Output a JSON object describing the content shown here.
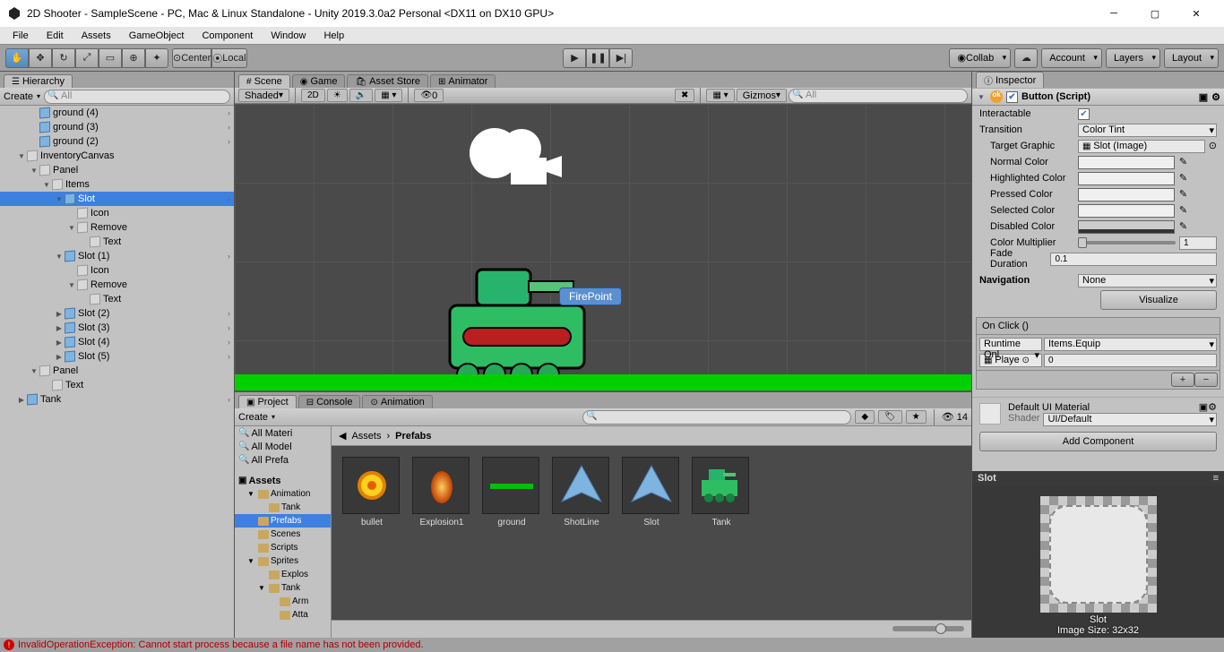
{
  "titlebar": "2D Shooter - SampleScene - PC, Mac & Linux Standalone - Unity 2019.3.0a2 Personal <DX11 on DX10 GPU>",
  "menu": [
    "File",
    "Edit",
    "Assets",
    "GameObject",
    "Component",
    "Window",
    "Help"
  ],
  "toolbar": {
    "center": "Center",
    "local": "Local",
    "collab": "Collab",
    "account": "Account",
    "layers": "Layers",
    "layout": "Layout"
  },
  "hierarchy": {
    "tab": "Hierarchy",
    "create": "Create",
    "searchPlaceholder": "All",
    "items": [
      {
        "name": "ground (4)",
        "indent": 2,
        "cube": "b",
        "arrow": true
      },
      {
        "name": "ground (3)",
        "indent": 2,
        "cube": "b",
        "arrow": true
      },
      {
        "name": "ground (2)",
        "indent": 2,
        "cube": "b",
        "arrow": true
      },
      {
        "name": "InventoryCanvas",
        "indent": 1,
        "fold": "▼",
        "cube": "g"
      },
      {
        "name": "Panel",
        "indent": 2,
        "fold": "▼",
        "cube": "g"
      },
      {
        "name": "Items",
        "indent": 3,
        "fold": "▼",
        "cube": "g"
      },
      {
        "name": "Slot",
        "indent": 4,
        "fold": "▼",
        "cube": "b",
        "sel": true,
        "arrow": true
      },
      {
        "name": "Icon",
        "indent": 5,
        "cube": "g"
      },
      {
        "name": "Remove",
        "indent": 5,
        "fold": "▼",
        "cube": "g"
      },
      {
        "name": "Text",
        "indent": 6,
        "cube": "g"
      },
      {
        "name": "Slot (1)",
        "indent": 4,
        "fold": "▼",
        "cube": "b",
        "arrow": true
      },
      {
        "name": "Icon",
        "indent": 5,
        "cube": "g"
      },
      {
        "name": "Remove",
        "indent": 5,
        "fold": "▼",
        "cube": "g"
      },
      {
        "name": "Text",
        "indent": 6,
        "cube": "g"
      },
      {
        "name": "Slot (2)",
        "indent": 4,
        "fold": "▶",
        "cube": "b",
        "arrow": true
      },
      {
        "name": "Slot (3)",
        "indent": 4,
        "fold": "▶",
        "cube": "b",
        "arrow": true
      },
      {
        "name": "Slot (4)",
        "indent": 4,
        "fold": "▶",
        "cube": "b",
        "arrow": true
      },
      {
        "name": "Slot (5)",
        "indent": 4,
        "fold": "▶",
        "cube": "b",
        "arrow": true
      },
      {
        "name": "Panel",
        "indent": 2,
        "fold": "▼",
        "cube": "g"
      },
      {
        "name": "Text",
        "indent": 3,
        "cube": "g"
      },
      {
        "name": "Tank",
        "indent": 1,
        "fold": "▶",
        "cube": "b",
        "arrow": true
      }
    ]
  },
  "scene": {
    "tabs": [
      "Scene",
      "Game",
      "Asset Store",
      "Animator"
    ],
    "shaded": "Shaded",
    "twoD": "2D",
    "gizmos": "Gizmos",
    "searchPlaceholder": "All",
    "firepoint": "FirePoint",
    "zero": "0"
  },
  "project": {
    "tabs": [
      "Project",
      "Console",
      "Animation"
    ],
    "create": "Create",
    "count": "14",
    "tree": [
      "All Materi",
      "All Model",
      "All Prefa"
    ],
    "assetsLabel": "Assets",
    "folders": [
      {
        "name": "Animation",
        "fold": "▼"
      },
      {
        "name": "Tank",
        "indent": 1
      },
      {
        "name": "Prefabs",
        "sel": true
      },
      {
        "name": "Scenes"
      },
      {
        "name": "Scripts"
      },
      {
        "name": "Sprites",
        "fold": "▼"
      },
      {
        "name": "Explos",
        "indent": 1
      },
      {
        "name": "Tank",
        "indent": 1,
        "fold": "▼"
      },
      {
        "name": "Arm",
        "indent": 2
      },
      {
        "name": "Atta",
        "indent": 2
      }
    ],
    "breadcrumb": [
      "Assets",
      "Prefabs"
    ],
    "assets": [
      "bullet",
      "Explosion1",
      "ground",
      "ShotLine",
      "Slot",
      "Tank"
    ]
  },
  "inspector": {
    "tab": "Inspector",
    "component": "Button (Script)",
    "interactable": "Interactable",
    "transition": "Transition",
    "transitionVal": "Color Tint",
    "targetGraphic": "Target Graphic",
    "targetGraphicVal": "Slot (Image)",
    "normalColor": "Normal Color",
    "highlightedColor": "Highlighted Color",
    "pressedColor": "Pressed Color",
    "selectedColor": "Selected Color",
    "disabledColor": "Disabled Color",
    "colorMultiplier": "Color Multiplier",
    "colorMultiplierVal": "1",
    "fadeDuration": "Fade Duration",
    "fadeDurationVal": "0.1",
    "navigation": "Navigation",
    "navigationVal": "None",
    "visualize": "Visualize",
    "onClick": "On Click ()",
    "runtime": "Runtime Onl",
    "method": "Items.Equip",
    "obj": "Playe",
    "arg": "0",
    "material": "Default UI Material",
    "shader": "Shader",
    "shaderVal": "UI/Default",
    "addComponent": "Add Component",
    "previewTitle": "Slot",
    "previewSub": "Slot",
    "previewSize": "Image Size: 32x32"
  },
  "error": "InvalidOperationException: Cannot start process because a file name has not been provided."
}
